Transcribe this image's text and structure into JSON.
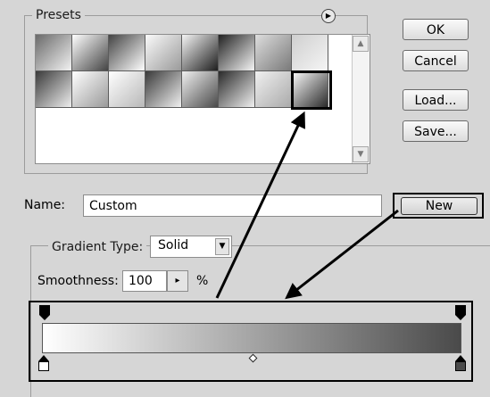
{
  "presets": {
    "label": "Presets",
    "menu_glyph": "▶",
    "swatches_row1": [
      "linear-gradient(135deg,#6a6a6a,#f2f2f2)",
      "linear-gradient(135deg,#ffffff,#444444)",
      "linear-gradient(135deg,#444444,#ffffff)",
      "linear-gradient(135deg,#fafafa,#9a9a9a)",
      "linear-gradient(135deg,#f5f5f5,#1e1e1e)",
      "linear-gradient(135deg,#222222,#f5f5f5)",
      "linear-gradient(135deg,#dddddd,#7a7a7a)",
      "linear-gradient(135deg,#cfcfcf,#f5f5f5)"
    ],
    "swatches_row2": [
      "linear-gradient(135deg,#3a3a3a,#eeeeee)",
      "linear-gradient(135deg,#ffffff,#9a9a9a)",
      "linear-gradient(135deg,#ffffff,#b8b8b8)",
      "linear-gradient(135deg,#3a3a3a,#f0f0f0)",
      "linear-gradient(135deg,#f0f0f0,#4a4a4a)",
      "linear-gradient(135deg,#2a2a2a,#f0f0f0)",
      "linear-gradient(135deg,#f0f0f0,#aaaaaa)",
      "linear-gradient(135deg,#ffffff,#2a2a2a)"
    ]
  },
  "buttons": {
    "ok": "OK",
    "cancel": "Cancel",
    "load": "Load...",
    "save": "Save...",
    "new": "New"
  },
  "name": {
    "label": "Name:",
    "value": "Custom"
  },
  "gradient_type": {
    "label": "Gradient Type:",
    "value": "Solid"
  },
  "smoothness": {
    "label": "Smoothness:",
    "value": "100",
    "unit": "%"
  },
  "gradient_bar": {
    "gradient": "linear-gradient(to right,#ffffff,#4a4a4a)"
  },
  "colors": {
    "background": "#d6d6d6",
    "border": "#9c9c9c",
    "highlight": "#000000"
  }
}
